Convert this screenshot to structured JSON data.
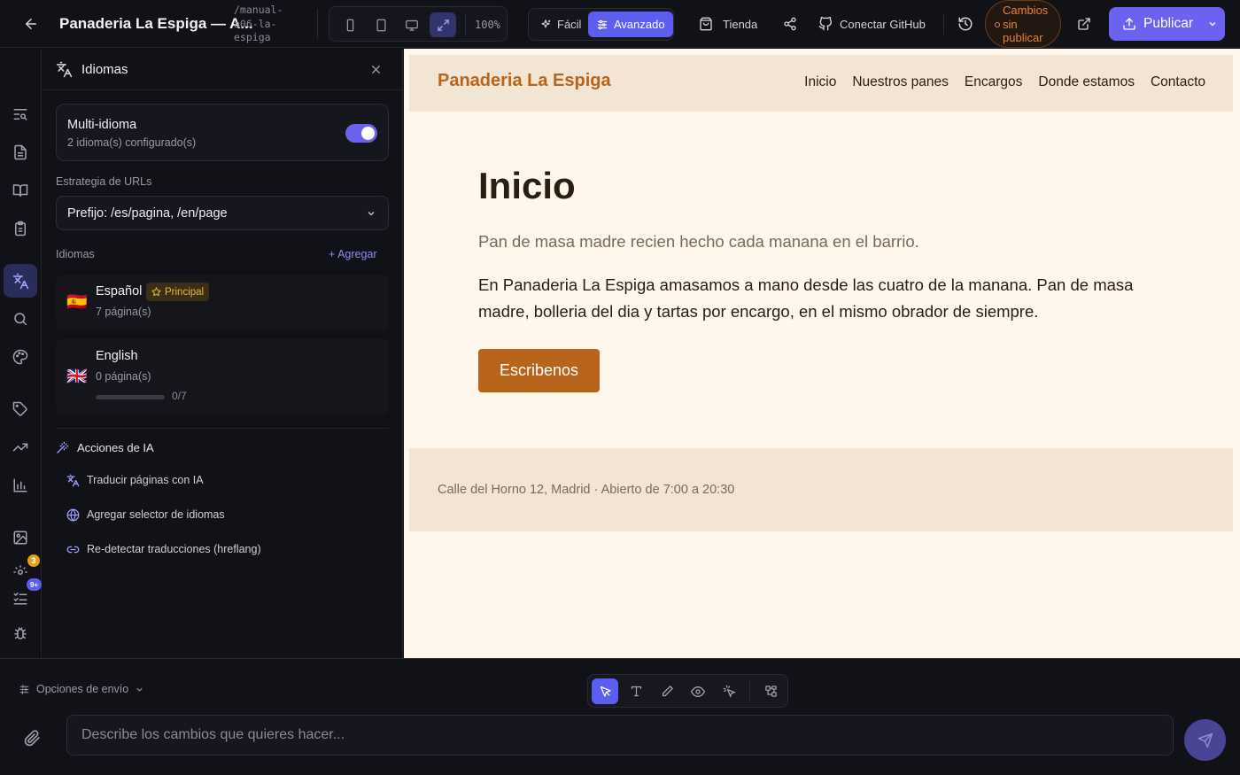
{
  "topbar": {
    "project_title": "Panaderia La Espiga — A...",
    "project_path": "/manual-a06-la-espiga",
    "zoom": "100%",
    "mode_easy": "Fácil",
    "mode_advanced": "Avanzado",
    "store": "Tienda",
    "github": "Conectar GitHub",
    "unsaved": "Cambios sin publicar",
    "publish": "Publicar"
  },
  "rail": {
    "badge_warnings": "3",
    "badge_tasks": "9+"
  },
  "panel": {
    "title": "Idiomas",
    "multi_title": "Multi-idioma",
    "multi_sub": "2 idioma(s) configurado(s)",
    "multi_enabled": true,
    "url_strategy_label": "Estrategia de URLs",
    "url_strategy_value": "Prefijo: /es/pagina, /en/page",
    "languages_label": "Idiomas",
    "add_label": "+ Agregar",
    "languages": [
      {
        "flag": "🇪🇸",
        "name": "Español",
        "badge": "Principal",
        "pages": "7 página(s)"
      },
      {
        "flag": "🇬🇧",
        "name": "English",
        "pages": "0 página(s)",
        "progress_text": "0/7",
        "progress": 0
      }
    ],
    "ai_label": "Acciones de IA",
    "ai_actions": [
      "Traducir páginas con IA",
      "Agregar selector de idiomas",
      "Re-detectar traducciones (hreflang)"
    ]
  },
  "preview": {
    "logo": "Panaderia La Espiga",
    "nav": [
      "Inicio",
      "Nuestros panes",
      "Encargos",
      "Donde estamos",
      "Contacto"
    ],
    "hero_title": "Inicio",
    "hero_sub": "Pan de masa madre recien hecho cada manana en el barrio.",
    "hero_body": "En Panaderia La Espiga amasamos a mano desde las cuatro de la manana. Pan de masa madre, bolleria del dia y tartas por encargo, en el mismo obrador de siempre.",
    "cta": "Escribenos",
    "footer": "Calle del Horno 12, Madrid · Abierto de 7:00 a 20:30"
  },
  "composer": {
    "send_options": "Opciones de envío",
    "placeholder": "Describe los cambios que quieres hacer..."
  },
  "colors": {
    "accent": "#6b63f0",
    "brand": "#b8651b",
    "warning": "#e8832f"
  }
}
